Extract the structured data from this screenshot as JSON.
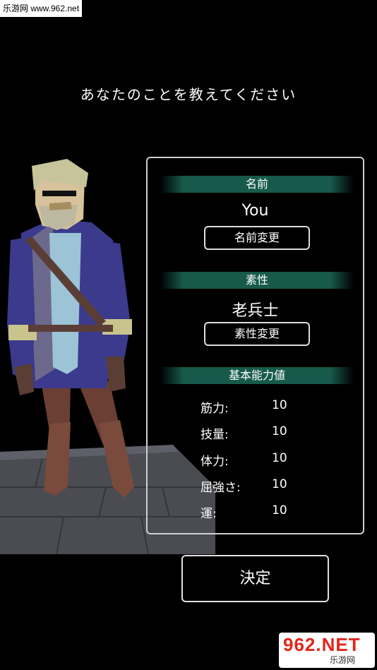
{
  "watermark_top": "乐游网 www.962.net",
  "prompt": "あなたのことを教えてください",
  "name": {
    "header": "名前",
    "value": "You",
    "button": "名前変更"
  },
  "trait": {
    "header": "素性",
    "value": "老兵士",
    "button": "素性変更"
  },
  "stats": {
    "header": "基本能力値",
    "items": [
      {
        "label": "筋力:",
        "value": "10"
      },
      {
        "label": "技量:",
        "value": "10"
      },
      {
        "label": "体力:",
        "value": "10"
      },
      {
        "label": "屈強さ:",
        "value": "10"
      },
      {
        "label": "運:",
        "value": "10"
      }
    ]
  },
  "confirm_button": "決定",
  "watermark_bottom": {
    "big": "962.NET",
    "small": "乐游网"
  },
  "colors": {
    "section_bar": "#175a4c",
    "coat": "#3b3a8c",
    "trim": "#c9c38e"
  }
}
